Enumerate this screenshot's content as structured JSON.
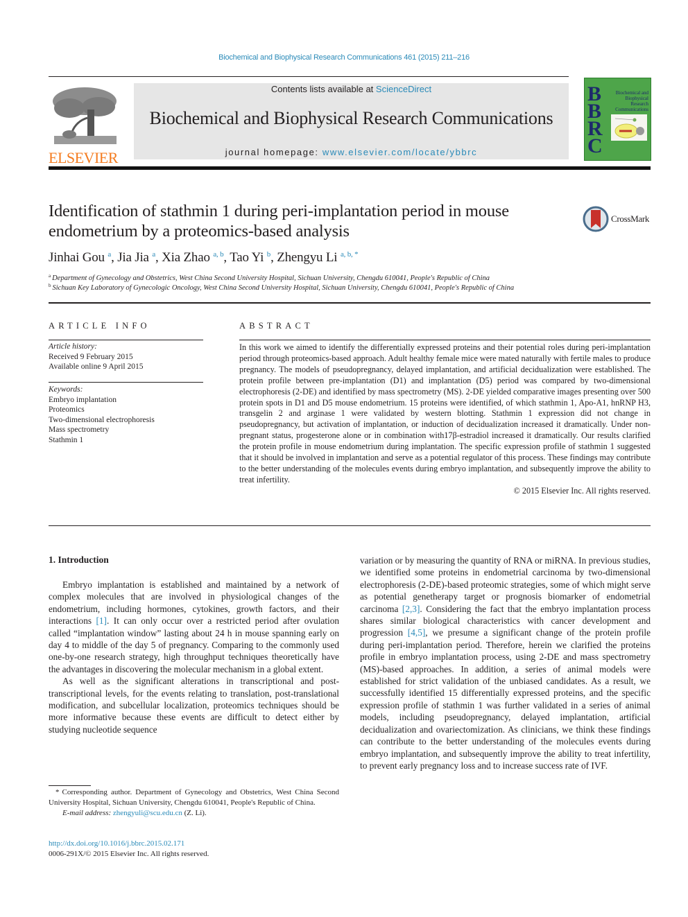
{
  "header": {
    "citation": "Biochemical and Biophysical Research Communications 461 (2015) 211–216",
    "contents_prefix": "Contents lists available at ",
    "contents_link": "ScienceDirect",
    "journal_name": "Biochemical and Biophysical Research Communications",
    "homepage_prefix": "journal homepage: ",
    "homepage_link": "www.elsevier.com/locate/ybbrc",
    "publisher_logo": "ELSEVIER",
    "cover": {
      "letters": [
        "B",
        "B",
        "R",
        "C"
      ],
      "title": "Biochemical and Biophysical Research Communications",
      "bg_color": "#4ea54a"
    },
    "crossmark_label": "CrossMark"
  },
  "article": {
    "title": "Identification of stathmin 1 during peri-implantation period in mouse endometrium by a proteomics-based analysis",
    "authors": [
      {
        "name": "Jinhai Gou",
        "sup": "a"
      },
      {
        "name": "Jia Jia",
        "sup": "a"
      },
      {
        "name": "Xia Zhao",
        "sup": "a, b"
      },
      {
        "name": "Tao Yi",
        "sup": "b"
      },
      {
        "name": "Zhengyu Li",
        "sup": "a, b, *"
      }
    ],
    "affiliations": [
      {
        "mark": "a",
        "text": "Department of Gynecology and Obstetrics, West China Second University Hospital, Sichuan University, Chengdu 610041, People's Republic of China"
      },
      {
        "mark": "b",
        "text": "Sichuan Key Laboratory of Gynecologic Oncology, West China Second University Hospital, Sichuan University, Chengdu 610041, People's Republic of China"
      }
    ]
  },
  "article_info": {
    "heading": "ARTICLE INFO",
    "history_label": "Article history:",
    "received": "Received 9 February 2015",
    "available": "Available online 9 April 2015",
    "keywords_label": "Keywords:",
    "keywords": [
      "Embryo implantation",
      "Proteomics",
      "Two-dimensional electrophoresis",
      "Mass spectrometry",
      "Stathmin 1"
    ]
  },
  "abstract": {
    "heading": "ABSTRACT",
    "text": "In this work we aimed to identify the differentially expressed proteins and their potential roles during peri-implantation period through proteomics-based approach. Adult healthy female mice were mated naturally with fertile males to produce pregnancy. The models of pseudopregnancy, delayed implantation, and artificial decidualization were established. The protein profile between pre-implantation (D1) and implantation (D5) period was compared by two-dimensional electrophoresis (2-DE) and identified by mass spectrometry (MS). 2-DE yielded comparative images presenting over 500 protein spots in D1 and D5 mouse endometrium. 15 proteins were identified, of which stathmin 1, Apo-A1, hnRNP H3, transgelin 2 and arginase 1 were validated by western blotting. Stathmin 1 expression did not change in pseudopregnancy, but activation of implantation, or induction of decidualization increased it dramatically. Under non-pregnant status, progesterone alone or in combination with17β-estradiol increased it dramatically. Our results clarified the protein profile in mouse endometrium during implantation. The specific expression profile of stathmin 1 suggested that it should be involved in implantation and serve as a potential regulator of this process. These findings may contribute to the better understanding of the molecules events during embryo implantation, and subsequently improve the ability to treat infertility.",
    "copyright": "© 2015 Elsevier Inc. All rights reserved."
  },
  "body": {
    "intro_heading": "1.  Introduction",
    "left_p1_a": "Embryo implantation is established and maintained by a network of complex molecules that are involved in physiological changes of the endometrium, including hormones, cytokines, growth factors, and their interactions ",
    "left_p1_ref": "[1]",
    "left_p1_b": ". It can only occur over a restricted period after ovulation called “implantation window” lasting about 24 h in mouse spanning early on day 4 to middle of the day 5 of pregnancy. Comparing to the commonly used one-by-one research strategy, high throughput techniques theoretically have the advantages in discovering the molecular mechanism in a global extent.",
    "left_p2": "As well as the significant alterations in transcriptional and post-transcriptional levels, for the events relating to translation, post-translational modification, and subcellular localization, proteomics techniques should be more informative because these events are difficult to detect either by studying nucleotide sequence",
    "right_a": "variation or by measuring the quantity of RNA or miRNA. In previous studies, we identified some proteins in endometrial carcinoma by two-dimensional electrophoresis (2-DE)-based proteomic strategies, some of which might serve as potential genetherapy target or prognosis biomarker of endometrial carcinoma ",
    "right_ref1": "[2,3]",
    "right_b": ". Considering the fact that the embryo implantation process shares similar biological characteristics with cancer development and progression ",
    "right_ref2": "[4,5]",
    "right_c": ", we presume a significant change of the protein profile during peri-implantation period. Therefore, herein we clarified the proteins profile in embryo implantation process, using 2-DE and mass spectrometry (MS)-based approaches. In addition, a series of animal models were established for strict validation of the unbiased candidates. As a result, we successfully identified 15 differentially expressed proteins, and the specific expression profile of stathmin 1 was further validated in a series of animal models, including pseudopregnancy, delayed implantation, artificial decidualization and ovariectomization. As clinicians, we think these findings can contribute to the better understanding of the molecules events during embryo implantation, and subsequently improve the ability to treat infertility, to prevent early pregnancy loss and to increase success rate of IVF."
  },
  "footnote": {
    "star": "*",
    "text": "Corresponding author. Department of Gynecology and Obstetrics, West China Second University Hospital, Sichuan University, Chengdu 610041, People's Republic of China.",
    "email_label": "E-mail address: ",
    "email": "zhengyuli@scu.edu.cn",
    "email_suffix": " (Z. Li).",
    "doi": "http://dx.doi.org/10.1016/j.bbrc.2015.02.171",
    "issn": "0006-291X/© 2015 Elsevier Inc. All rights reserved."
  }
}
